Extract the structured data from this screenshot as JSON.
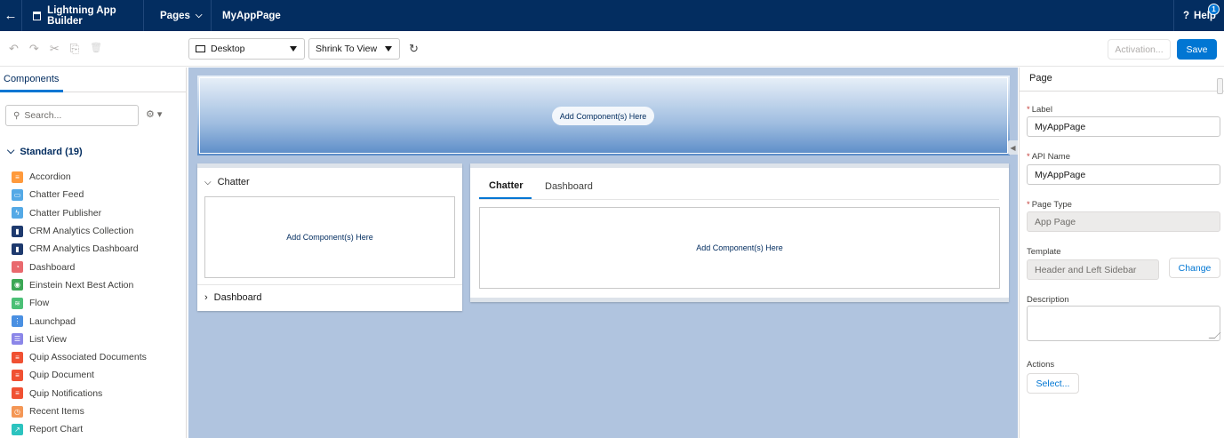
{
  "topbar": {
    "back_icon": "←",
    "app_title": "Lightning App Builder",
    "pages_menu": "Pages",
    "page_name": "MyAppPage",
    "help_label": "Help",
    "help_badge": "1"
  },
  "toolbar": {
    "undo_icon": "↶",
    "redo_icon": "↷",
    "cut_icon": "✂",
    "copy_icon": "⎘",
    "delete_icon": "🗑",
    "device_select": "Desktop",
    "zoom_select": "Shrink To View",
    "refresh_icon": "↻",
    "activation_label": "Activation...",
    "save_label": "Save"
  },
  "left": {
    "tab_label": "Components",
    "search_placeholder": "Search...",
    "section_label": "Standard (19)",
    "components": [
      {
        "label": "Accordion",
        "color": "#ff9a3c",
        "glyph": "≡"
      },
      {
        "label": "Chatter Feed",
        "color": "#54a9e6",
        "glyph": "▭"
      },
      {
        "label": "Chatter Publisher",
        "color": "#54a9e6",
        "glyph": "ϟ"
      },
      {
        "label": "CRM Analytics Collection",
        "color": "#1e3a6e",
        "glyph": "▮"
      },
      {
        "label": "CRM Analytics Dashboard",
        "color": "#1e3a6e",
        "glyph": "▮"
      },
      {
        "label": "Dashboard",
        "color": "#e9696e",
        "glyph": "◔"
      },
      {
        "label": "Einstein Next Best Action",
        "color": "#3ba755",
        "glyph": "◉"
      },
      {
        "label": "Flow",
        "color": "#4bc076",
        "glyph": "≋"
      },
      {
        "label": "Launchpad",
        "color": "#4a90e2",
        "glyph": "⋮"
      },
      {
        "label": "List View",
        "color": "#8b86e8",
        "glyph": "☰"
      },
      {
        "label": "Quip Associated Documents",
        "color": "#f05133",
        "glyph": "≡"
      },
      {
        "label": "Quip Document",
        "color": "#f05133",
        "glyph": "≡"
      },
      {
        "label": "Quip Notifications",
        "color": "#f05133",
        "glyph": "≡"
      },
      {
        "label": "Recent Items",
        "color": "#f49756",
        "glyph": "◷"
      },
      {
        "label": "Report Chart",
        "color": "#2cc3bf",
        "glyph": "↗"
      }
    ]
  },
  "canvas": {
    "header_drop": "Add Component(s) Here",
    "left_card": {
      "section1": "Chatter",
      "drop": "Add Component(s) Here",
      "section2": "Dashboard"
    },
    "right_card": {
      "tabs": [
        "Chatter",
        "Dashboard"
      ],
      "drop": "Add Component(s) Here"
    }
  },
  "panel": {
    "title": "Page",
    "label_label": "Label",
    "label_value": "MyAppPage",
    "api_label": "API Name",
    "api_value": "MyAppPage",
    "type_label": "Page Type",
    "type_value": "App Page",
    "template_label": "Template",
    "template_value": "Header and Left Sidebar",
    "change_label": "Change",
    "description_label": "Description",
    "actions_label": "Actions",
    "select_label": "Select..."
  }
}
